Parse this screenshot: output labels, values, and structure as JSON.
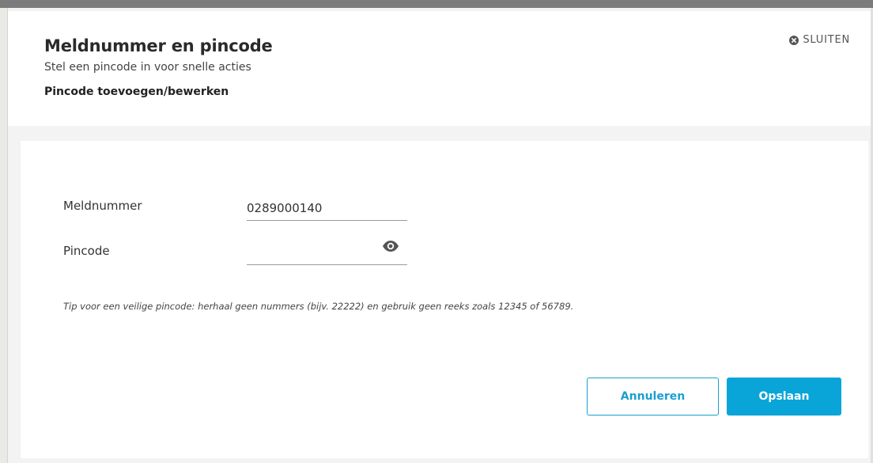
{
  "modal": {
    "title": "Meldnummer en pincode",
    "subtitle": "Stel een pincode in voor snelle acties",
    "section_label": "Pincode toevoegen/bewerken",
    "close_label": "SLUITEN",
    "close_icon": "close-circle-icon"
  },
  "form": {
    "meldnummer_label": "Meldnummer",
    "meldnummer_value": "0289000140",
    "pincode_label": "Pincode",
    "pincode_value": "",
    "pincode_visibility_icon": "eye-icon",
    "tip": "Tip voor een veilige pincode: herhaal geen nummers (bijv. 22222) en gebruik geen reeks zoals 12345 of 56789."
  },
  "actions": {
    "cancel_label": "Annuleren",
    "save_label": "Opslaan"
  },
  "colors": {
    "accent": "#0aa5d8",
    "header_strip": "#7b7b7b",
    "body_bg": "#f3f3f3"
  }
}
